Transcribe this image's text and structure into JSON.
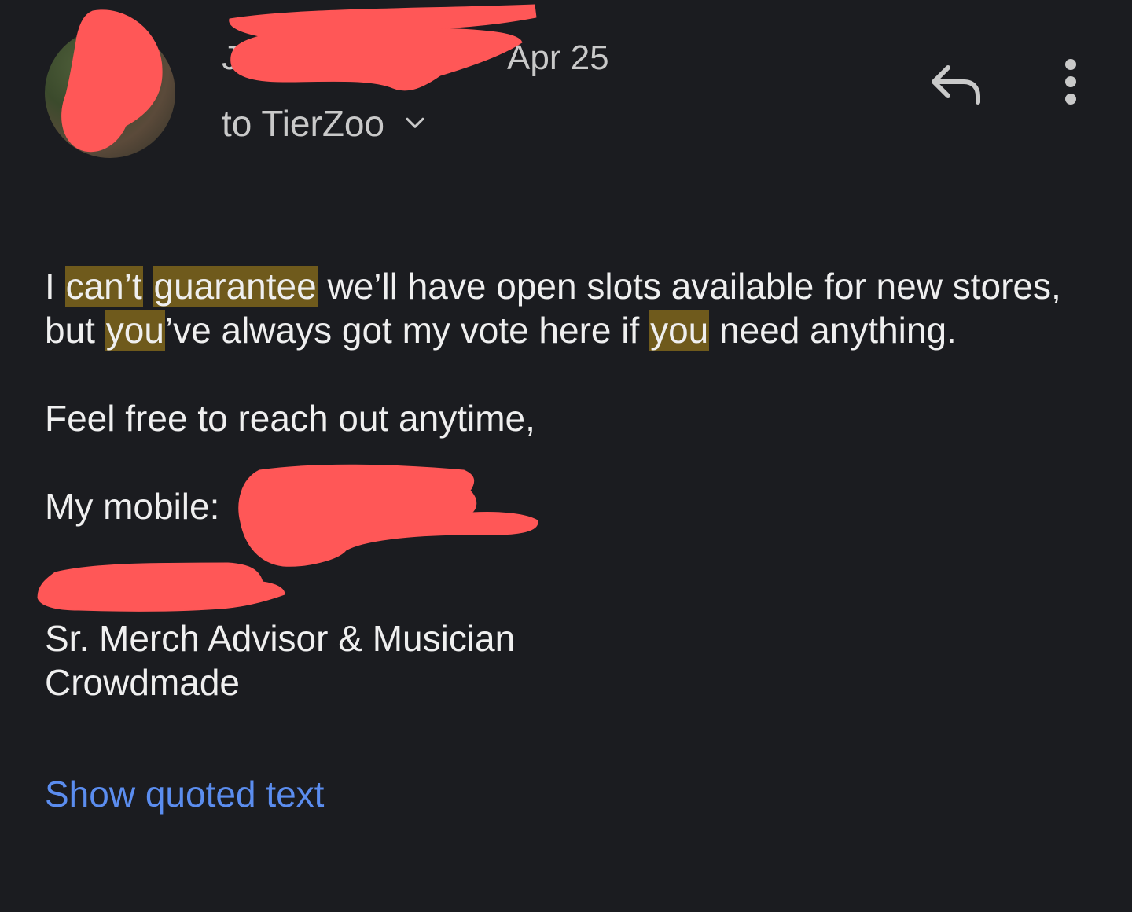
{
  "header": {
    "sender_name": "J",
    "date": "Apr 25",
    "to_line": "to TierZoo"
  },
  "icons": {
    "reply": "reply-icon",
    "more": "more-vertical-icon",
    "expand": "chevron-down-icon"
  },
  "message": {
    "line1": {
      "t1": "I ",
      "h1": "can’t",
      "t2": " ",
      "h2": "guarantee",
      "t3": " we’ll have open slots available for new stores,"
    },
    "line2": {
      "t1": "but ",
      "h1": "you",
      "t2": "’ve always got my vote here if ",
      "h2": "you",
      "t3": " need anything."
    },
    "closing": "Feel free to reach out anytime,",
    "mobile_label": "My mobile:",
    "signature_title": "Sr. Merch Advisor & Musician",
    "signature_company": "Crowdmade"
  },
  "actions": {
    "show_quoted": "Show quoted text"
  },
  "colors": {
    "background": "#1b1c20",
    "highlight": "#6f5a1c",
    "link": "#5b8def",
    "redaction": "#ff5757"
  }
}
